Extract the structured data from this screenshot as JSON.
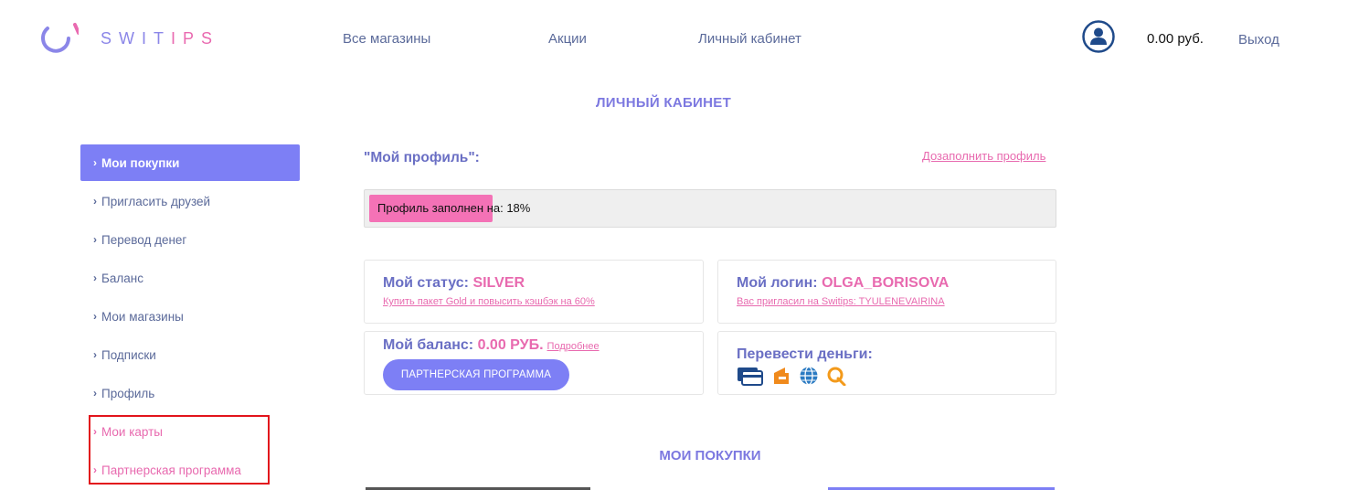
{
  "header": {
    "logo_text_a": "SWIT",
    "logo_text_b": "IPS",
    "nav": [
      "Все магазины",
      "Акции",
      "Личный кабинет"
    ],
    "balance": "0.00 руб.",
    "logout": "Выход"
  },
  "page_title": "ЛИЧНЫЙ КАБИНЕТ",
  "sidebar": {
    "items": [
      {
        "label": "Мои покупки"
      },
      {
        "label": "Пригласить друзей"
      },
      {
        "label": "Перевод денег"
      },
      {
        "label": "Баланс"
      },
      {
        "label": "Мои магазины"
      },
      {
        "label": "Подписки"
      },
      {
        "label": "Профиль"
      },
      {
        "label": "Мои карты"
      },
      {
        "label": "Партнерская программа"
      }
    ]
  },
  "profile": {
    "label": "\"Мой профиль\":",
    "complete_link": "Дозаполнить профиль",
    "progress_text": "Профиль заполнен на: 18%",
    "progress_percent": 18
  },
  "cards": {
    "status": {
      "label": "Мой статус:",
      "value": "SILVER",
      "link": "Купить пакет Gold и повысить кэшбэк на 60%"
    },
    "login": {
      "label": "Мой логин:",
      "value": "OLGA_BORISOVA",
      "link": "Вас пригласил на Switips: TYULENEVAIRINA"
    },
    "balance": {
      "label": "Мой баланс:",
      "value": "0.00 РУБ.",
      "more": "Подробнее",
      "button": "ПАРТНЕРСКАЯ ПРОГРАММА"
    },
    "transfer": {
      "label": "Перевести деньги:"
    }
  },
  "purchases_title": "МОИ ПОКУПКИ",
  "colors": {
    "accent": "#7d7ff5",
    "pink": "#e86aaf",
    "highlight_red": "#e2141c"
  }
}
